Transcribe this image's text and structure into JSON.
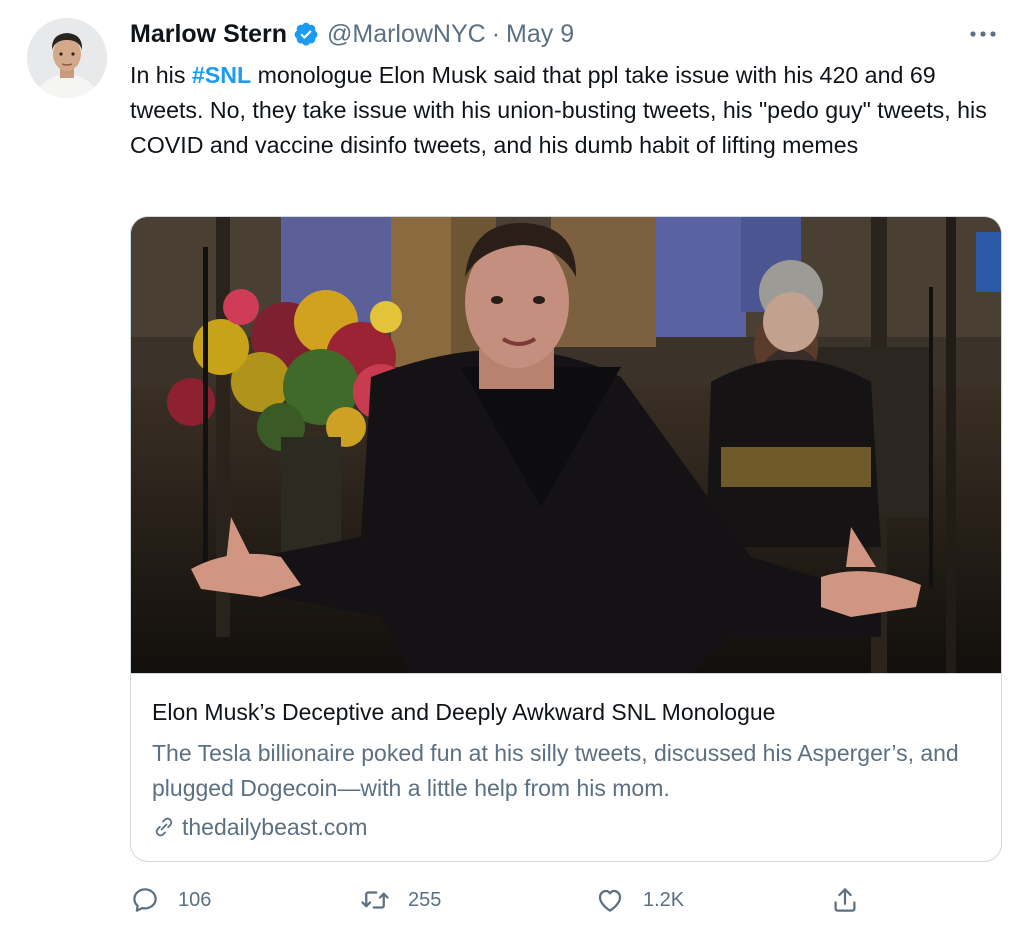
{
  "author": {
    "name": "Marlow Stern",
    "handle": "@MarlowNYC",
    "separator": "·",
    "date": "May 9"
  },
  "tweet": {
    "text_before": "In his ",
    "hashtag": "#SNL",
    "text_after": " monologue Elon Musk said that ppl take issue with his 420 and 69 tweets. No, they take issue with his union-busting tweets, his \"pedo guy\" tweets, his COVID and vaccine disinfo tweets, and his dumb habit of lifting memes"
  },
  "card": {
    "title": "Elon Musk’s Deceptive and Deeply Awkward SNL Monologue",
    "description": "The Tesla billionaire poked fun at his silly tweets, discussed his Asperger’s, and plugged Dogecoin—with a little help from his mom.",
    "domain": "thedailybeast.com"
  },
  "actions": {
    "reply_count": "106",
    "retweet_count": "255",
    "like_count": "1.2K"
  },
  "icons": {
    "verified": "verified-badge-icon",
    "more": "more-options-icon",
    "reply": "reply-icon",
    "retweet": "retweet-icon",
    "like": "heart-icon",
    "share": "share-icon",
    "link": "link-icon"
  },
  "colors": {
    "accent": "#1d9bf0",
    "secondary_text": "#5b7083",
    "border": "#cfd9de"
  }
}
